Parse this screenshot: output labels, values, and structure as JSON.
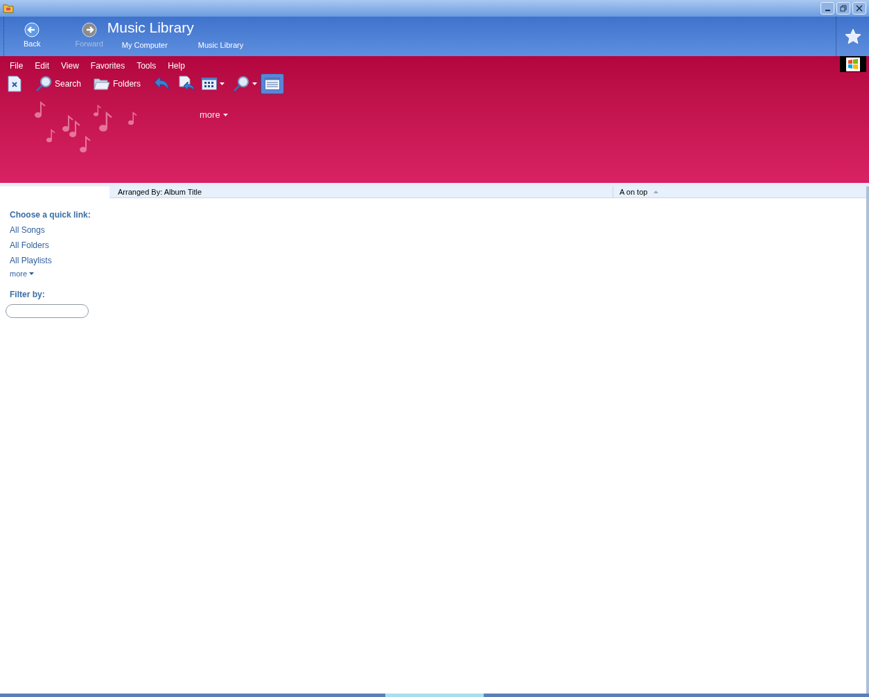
{
  "nav": {
    "back": "Back",
    "forward": "Forward",
    "title": "Music Library",
    "breadcrumbs": [
      "My Computer",
      "Music Library"
    ]
  },
  "menu": [
    "File",
    "Edit",
    "View",
    "Favorites",
    "Tools",
    "Help"
  ],
  "toolbar": [
    {
      "kind": "close-doc"
    },
    {
      "kind": "search",
      "label": "Search"
    },
    {
      "kind": "folders",
      "label": "Folders"
    },
    {
      "kind": "undo"
    },
    {
      "kind": "move"
    },
    {
      "kind": "views"
    },
    {
      "kind": "zoom"
    },
    {
      "kind": "calendar",
      "selected": true
    }
  ],
  "banner": {
    "more": "more"
  },
  "sidebar": {
    "heading": "Choose a quick link:",
    "links": [
      "All Songs",
      "All Folders",
      "All Playlists"
    ],
    "more": "more",
    "filter_label": "Filter by:"
  },
  "columns": [
    {
      "label": "Arranged By: Album Title"
    },
    {
      "label": "A on top",
      "sort_ascending": true
    }
  ]
}
